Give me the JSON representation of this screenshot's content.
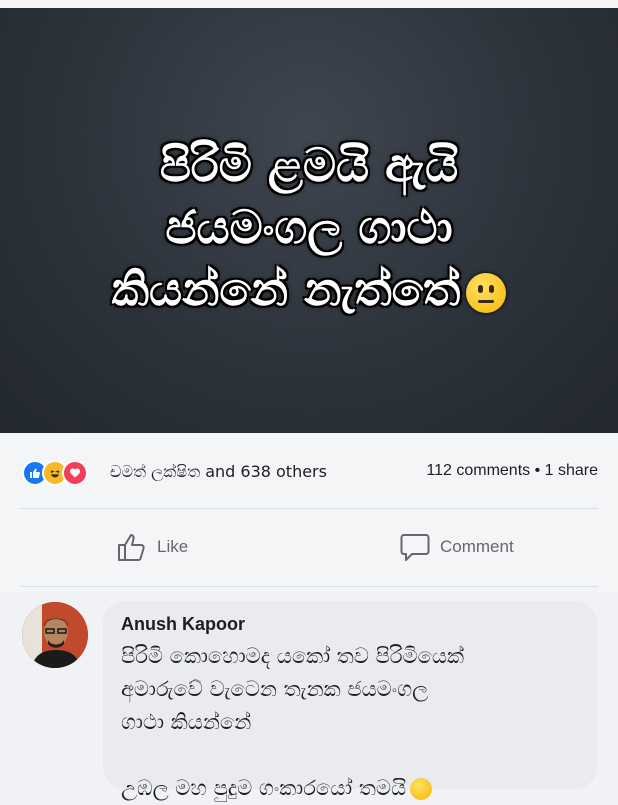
{
  "image": {
    "line1": "පිරිමි ළමයි ඇයි",
    "line2": "ජයමංගල ගාථා",
    "line3": "කියන්නේ නැත්තේ"
  },
  "reactions": {
    "names": "චමත් ලක්ෂිත and 638 others",
    "counts": "112 comments • 1 share"
  },
  "actions": {
    "like": "Like",
    "comment": "Comment"
  },
  "comment": {
    "author": "Anush Kapoor",
    "text": "පිරිමි කොහොමද යකෝ තව පිරිමියෙක්\nඅමාරුවේ වැටෙන තැනක ජයමංගල\nගාථා කියන්නේ\n\nඋඹල මහ පුදුම ගංකාරයෝ තමයි"
  },
  "colors": {
    "like_blue": "#1877f2",
    "haha_yellow": "#f7b928",
    "love_red": "#f33e58"
  },
  "icons": [
    "like-reaction-icon",
    "haha-reaction-icon",
    "love-reaction-icon",
    "thumbs-up-icon",
    "comment-icon",
    "neutral-face-emoji",
    "smile-emoji"
  ]
}
